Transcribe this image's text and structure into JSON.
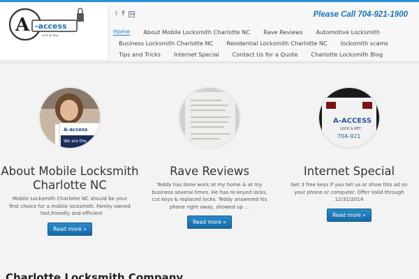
{
  "site": {
    "phone_text": "Please Call 704-921-1900",
    "logo_label": "A-access locksmith logo",
    "accent_color": "#1e7cc2"
  },
  "social": {
    "twitter_glyph": "t",
    "facebook_glyph": "f",
    "linkedin_glyph": "in"
  },
  "nav": {
    "row1": [
      "Home",
      "About Mobile Locksmith Charlotte NC",
      "Rave Reviews",
      "Automotive Locksmith"
    ],
    "row2": [
      "Business Locksmith Charlotte NC",
      "Residential Locksmith Charlotte NC",
      "locksmith scams"
    ],
    "row3": [
      "Tips and Tricks",
      "Internet Special",
      "Contact Us for a Quote",
      "Charlotte Locksmith Blog"
    ]
  },
  "features": [
    {
      "title": "About Mobile Locksmith Charlotte NC",
      "text": "Mobile Locksmith Charlotte NC should be your first choice for a mobile locksmith. Family owned . fast,friendly and efficient",
      "button": "Read more »"
    },
    {
      "title": "Rave Reviews",
      "text": "Teddy has done work at my home & at my business several times. He has re-keyed locks, cut keys & replaced locks. Teddy answered his phone right away, showed up …",
      "button": "Read more »"
    },
    {
      "title": "Internet Special",
      "text": "Get 3 free keys if you tell us or show this ad on your phone or computer. Offer Valid through 12/31/2014",
      "button": "Read more »"
    }
  ],
  "bottom": {
    "heading": "Charlotte Locksmith Company"
  }
}
